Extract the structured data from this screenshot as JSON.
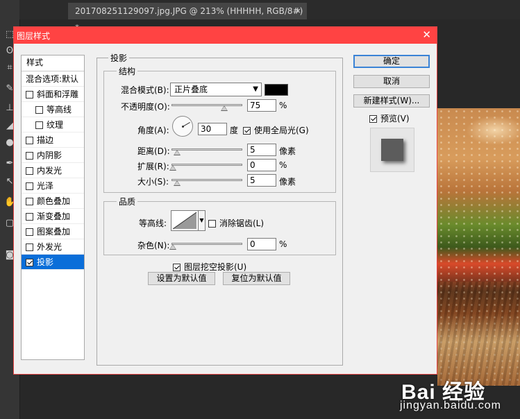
{
  "ps": {
    "tab_title": "201708251129097.jpg.JPG @ 213% (HHHHH, RGB/8#) *",
    "tab_close": "×"
  },
  "watermark": {
    "logo": "Bai 经验",
    "sub": "jingyan.baidu.com"
  },
  "dialog": {
    "title": "图层样式",
    "close": "✕",
    "styles_header": "样式",
    "blend_options": "混合选项:默认",
    "style_items": [
      {
        "label": "斜面和浮雕",
        "checked": false
      },
      {
        "label": "等高线",
        "checked": false,
        "sub": true
      },
      {
        "label": "纹理",
        "checked": false,
        "sub": true
      },
      {
        "label": "描边",
        "checked": false
      },
      {
        "label": "内阴影",
        "checked": false
      },
      {
        "label": "内发光",
        "checked": false
      },
      {
        "label": "光泽",
        "checked": false
      },
      {
        "label": "颜色叠加",
        "checked": false
      },
      {
        "label": "渐变叠加",
        "checked": false
      },
      {
        "label": "图案叠加",
        "checked": false
      },
      {
        "label": "外发光",
        "checked": false
      },
      {
        "label": "投影",
        "checked": true,
        "selected": true
      }
    ],
    "drop_shadow": {
      "group_title": "投影",
      "structure_title": "结构",
      "blend_mode_label": "混合模式(B):",
      "blend_mode_value": "正片叠底",
      "shadow_color": "#000000",
      "opacity_label": "不透明度(O):",
      "opacity_value": "75",
      "opacity_unit": "%",
      "angle_label": "角度(A):",
      "angle_value": "30",
      "angle_unit": "度",
      "global_light_label": "使用全局光(G)",
      "distance_label": "距离(D):",
      "distance_value": "5",
      "distance_unit": "像素",
      "spread_label": "扩展(R):",
      "spread_value": "0",
      "spread_unit": "%",
      "size_label": "大小(S):",
      "size_value": "5",
      "size_unit": "像素",
      "quality_title": "品质",
      "contour_label": "等高线:",
      "antialias_label": "消除锯齿(L)",
      "noise_label": "杂色(N):",
      "noise_value": "0",
      "noise_unit": "%",
      "knockout_label": "图层挖空投影(U)",
      "set_default": "设置为默认值",
      "reset_default": "复位为默认值"
    },
    "buttons": {
      "ok": "确定",
      "cancel": "取消",
      "new_style": "新建样式(W)...",
      "preview_label": "预览(V)"
    }
  }
}
